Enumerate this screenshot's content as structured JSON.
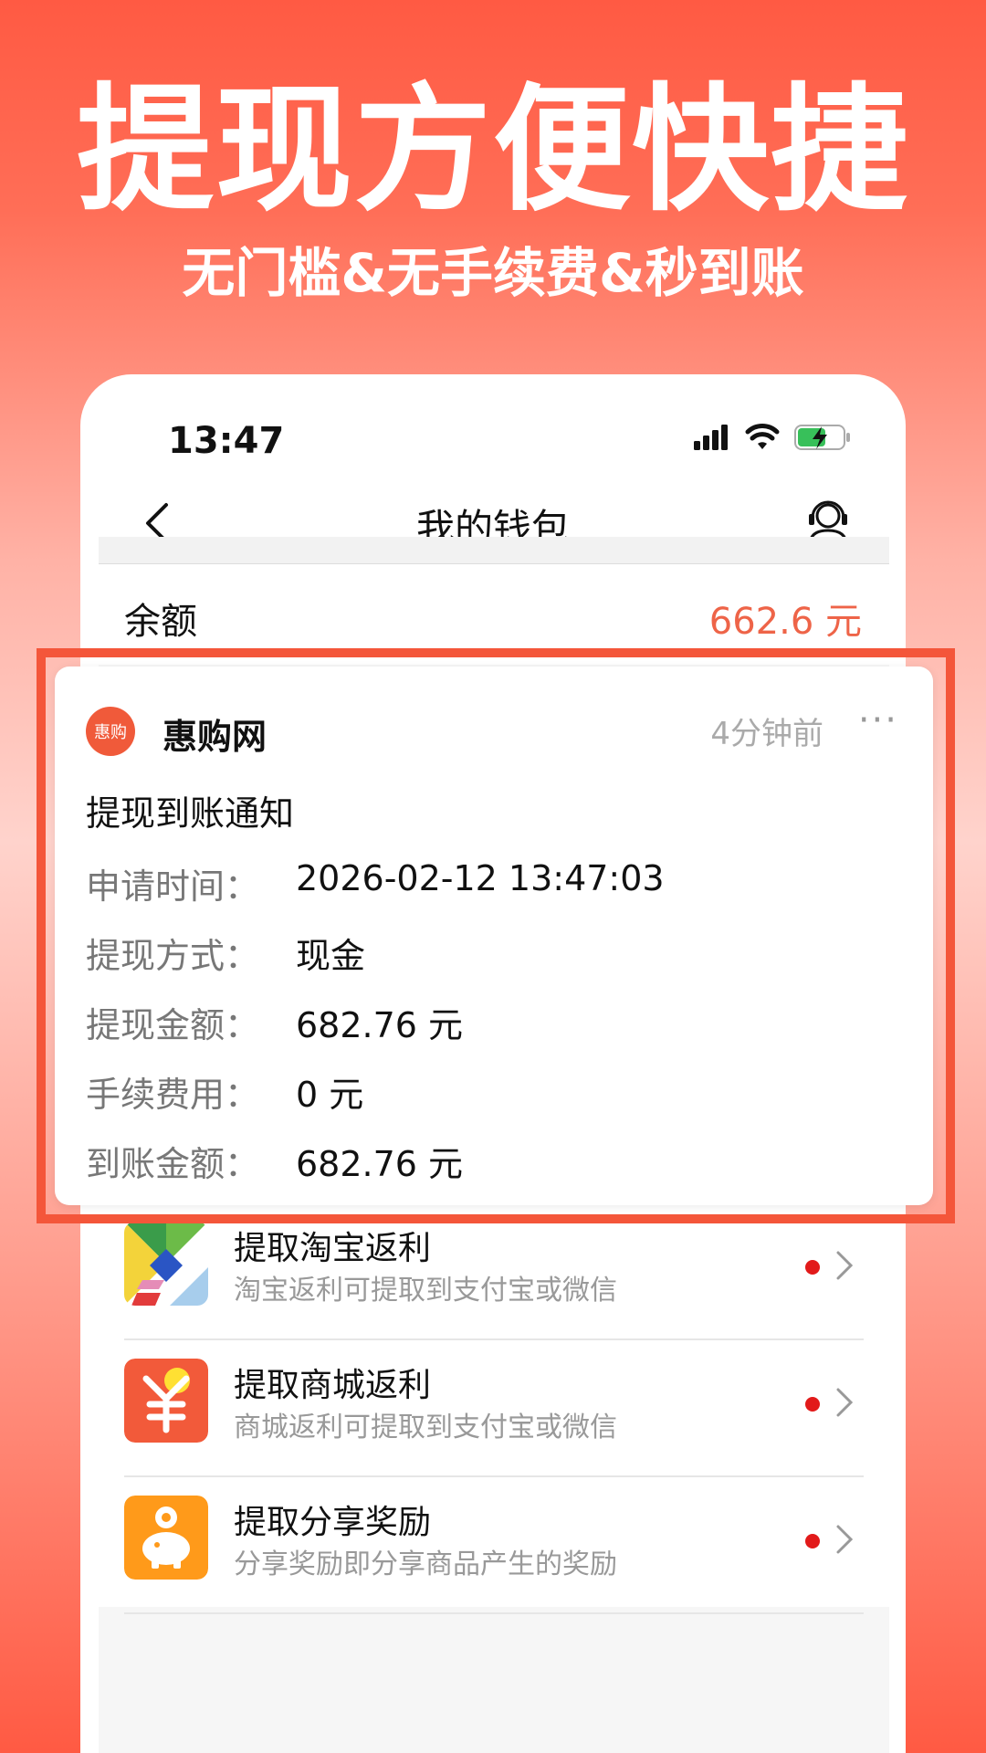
{
  "promo": {
    "headline": "提现方便快捷",
    "subheadline": "无门槛&无手续费&秒到账"
  },
  "status_bar": {
    "time": "13:47"
  },
  "nav": {
    "title": "我的钱包"
  },
  "balance": {
    "label": "余额",
    "value": "662.6 元"
  },
  "notification": {
    "app_name": "惠购网",
    "app_logo_text": "惠购",
    "time_ago": "4分钟前",
    "more": "···",
    "title": "提现到账通知",
    "fields": [
      {
        "label": "申请时间：",
        "value": "2026-02-12 13:47:03"
      },
      {
        "label": "提现方式：",
        "value": "现金"
      },
      {
        "label": "提现金额：",
        "value": "682.76 元"
      },
      {
        "label": "手续费用：",
        "value": "0 元"
      },
      {
        "label": "到账金额：",
        "value": "682.76 元"
      }
    ]
  },
  "list": {
    "items": [
      {
        "title": "提取淘宝返利",
        "subtitle": "淘宝返利可提取到支付宝或微信",
        "icon": "taobao-icon"
      },
      {
        "title": "提取商城返利",
        "subtitle": "商城返利可提取到支付宝或微信",
        "icon": "yuan-icon"
      },
      {
        "title": "提取分享奖励",
        "subtitle": "分享奖励即分享商品产生的奖励",
        "icon": "piggy-bank-icon"
      }
    ]
  },
  "colors": {
    "accent": "#f4563a",
    "balance": "#ee6448",
    "dot": "#e21a1a"
  }
}
